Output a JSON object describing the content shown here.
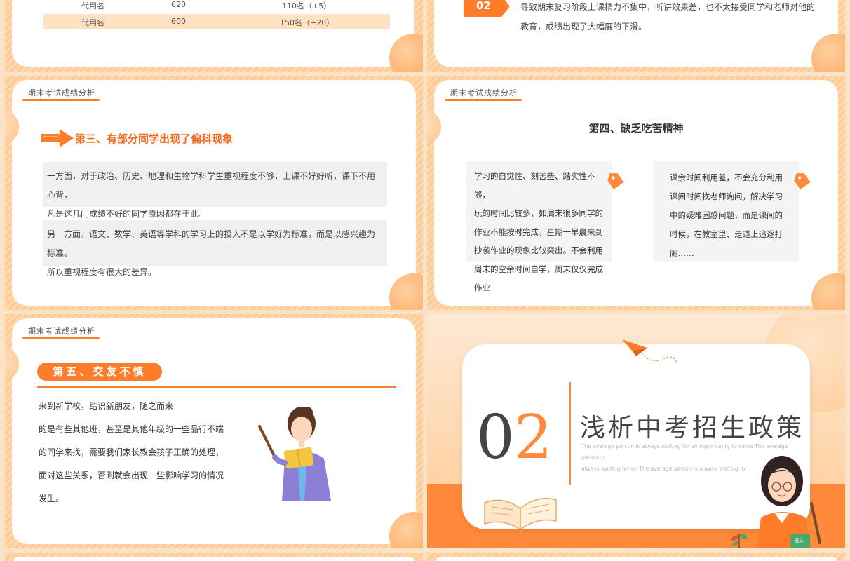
{
  "slide1": {
    "rows": [
      {
        "name": "代用名",
        "score": "620",
        "rank": "110名（+5）"
      },
      {
        "name": "代用名",
        "score": "600",
        "rank": "150名（+20）"
      }
    ]
  },
  "slide2": {
    "badge": "02",
    "lines": [
      "导致期末复习阶段上课精力不集中，听讲效果差，也不太接受同学和老师对他的",
      "教育，成绩出现了大幅度的下滑。"
    ]
  },
  "slide3": {
    "tag": "期末考试成绩分析",
    "title": "第三、有部分同学出现了偏科现象",
    "box1": [
      "一方面，对于政治、历史、地理和生物学科学生重视程度不够，上课不好好听，课下不用心背，",
      "凡是这几门成绩不好的同学原因都在于此。"
    ],
    "box2": [
      "另一方面，语文、数学、英语等学科的学习上的投入不是以学好为标准，而是以感兴趣为标准。",
      "所以重视程度有很大的差异。"
    ]
  },
  "slide4": {
    "tag": "期末考试成绩分析",
    "title": "第四、缺乏吃苦精神",
    "left": [
      "学习的自觉性、刻苦些、踏实性不够，",
      "玩的时间比较多，如周末很多同学的",
      "作业不能按时完成，星期一早晨来到",
      "抄袭作业的现象比较突出。不会利用",
      "周末的空余时间自学，周末仅仅完成",
      "作业"
    ],
    "right": [
      "课余时间利用差，不会充分利用",
      "课间时间找老师询问，解决学习",
      "中的疑难困惑问题，而是课间的",
      "时候，在教室里、走道上追逐打",
      "闹……"
    ]
  },
  "slide5": {
    "tag": "期末考试成绩分析",
    "title": "第五、交友不慎",
    "lines": [
      "来到新学校，结识新朋友，随之而来",
      "的是有些其他班，甚至是其他年级的一些品行不端",
      "的同学来找，需要我们家长教会孩子正确的处理、",
      "面对这些关系，否则就会出现一些影响学习的情况",
      "发生。"
    ]
  },
  "slide6": {
    "num_a": "0",
    "num_b": "2",
    "title": "浅析中考招生政策",
    "en1": "The average person is always waiting for an opportunity to come The average person is",
    "en2": "always waiting for an The average person is always waiting for",
    "book_label": "语文"
  },
  "colors": {
    "accent": "#ff7c2a",
    "bg": "#fbe3c7"
  }
}
